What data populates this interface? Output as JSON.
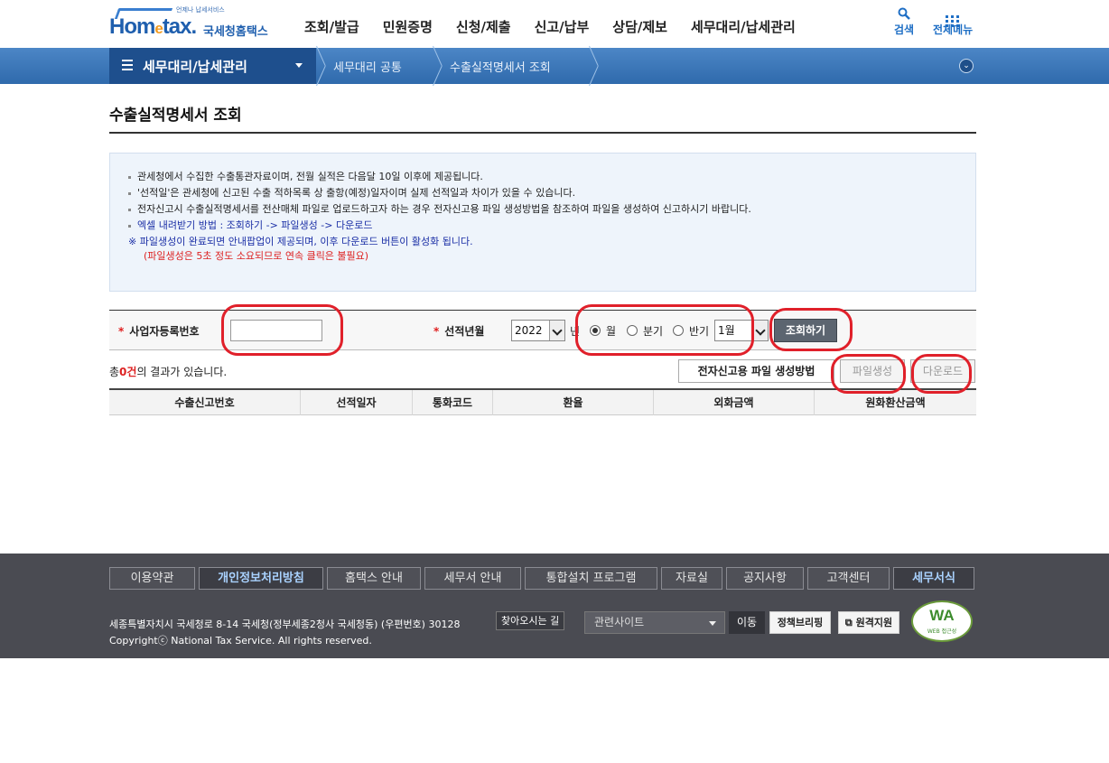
{
  "header": {
    "logo_sub": "언제나 납세서비스",
    "logo_main_a": "Hom",
    "logo_main_e": "e",
    "logo_main_b": "tax.",
    "logo_kr": "국세청홈택스",
    "gnb": [
      "조회/발급",
      "민원증명",
      "신청/제출",
      "신고/납부",
      "상담/제보",
      "세무대리/납세관리"
    ],
    "search_label": "검색",
    "allmenu_label": "전체메뉴"
  },
  "navbar": {
    "menu_title": "세무대리/납세관리",
    "crumbs": [
      "세무대리 공통",
      "수출실적명세서 조회"
    ]
  },
  "page": {
    "title": "수출실적명세서 조회"
  },
  "info": {
    "lines": [
      "관세청에서 수집한 수출통관자료이며, 전월 실적은 다음달 10일 이후에 제공됩니다.",
      "'선적일'은 관세청에 신고된 수출 적하목록 상 출항(예정)일자이며 실제 선적일과 차이가 있을 수 있습니다.",
      "전자신고시 수출실적명세서를 전산매체 파일로 업로드하고자 하는 경우 전자신고용 파일 생성방법을 참조하여 파일을 생성하여 신고하시기 바랍니다.",
      "엑셀 내려받기 방법 :  조회하기 ->  파일생성 -> 다운로드"
    ],
    "notice": "※ 파일생성이 완료되면 안내팝업이 제공되며, 이후  다운로드 버튼이 활성화 됩니다.",
    "notice_sub": "(파일생성은 5초 정도 소요되므로 연속 클릭은 불필요)"
  },
  "search": {
    "biz_label": "사업자등록번호",
    "biz_value": "",
    "ship_label": "선적년월",
    "year": "2022",
    "year_suffix": "년",
    "radio_month": "월",
    "radio_quarter": "분기",
    "radio_half": "반기",
    "period": "1월",
    "query_button": "조회하기"
  },
  "result": {
    "prefix": "총",
    "count": "0건",
    "suffix": "의 결과가 있습니다.",
    "btn_method": "전자신고용 파일 생성방법",
    "btn_file": "파일생성",
    "btn_download": "다운로드"
  },
  "table": {
    "columns": [
      "수출신고번호",
      "선적일자",
      "통화코드",
      "환율",
      "외화금액",
      "원화환산금액"
    ],
    "rows": []
  },
  "footer": {
    "links": [
      "이용약관",
      "개인정보처리방침",
      "홈택스 안내",
      "세무서 안내",
      "통합설치 프로그램",
      "자료실",
      "공지사항",
      "고객센터",
      "세무서식"
    ],
    "address": "세종특별자치시 국세청로 8-14 국세청(정부세종2청사 국세청동) (우편번호) 30128",
    "way_button": "찾아오시는 길",
    "copyright": "Copyrightⓒ National Tax Service. All rights reserved.",
    "related_select": "관련사이트",
    "go_button": "이동",
    "policy_briefing": "정책브리핑",
    "remote_support": "원격지원",
    "wa_mark": "WA",
    "wa_sub": "WEB 접근성"
  },
  "colors": {
    "annotation_red": "#e0202a",
    "navbar_blue": "#2f6aac",
    "brand_blue": "#1f5fae"
  }
}
